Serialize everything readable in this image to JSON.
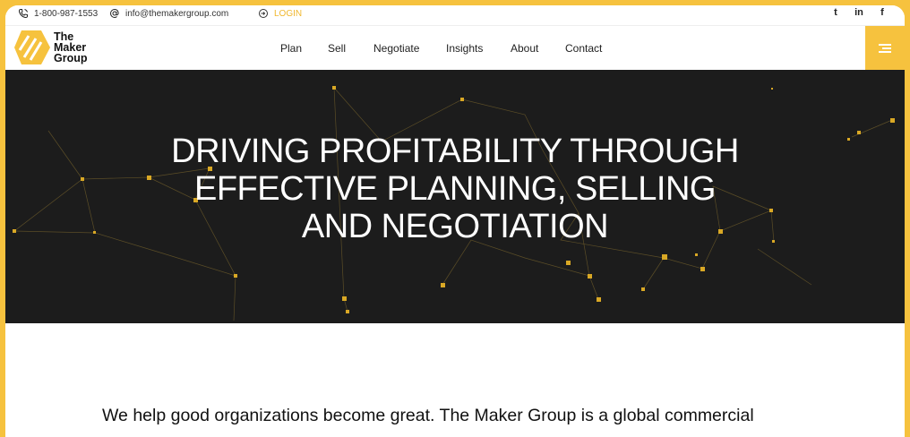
{
  "contact": {
    "phone": "1-800-987-1553",
    "email": "info@themakergroup.com",
    "login": "LOGIN"
  },
  "social": {
    "twitter": "t",
    "linkedin": "in",
    "facebook": "f"
  },
  "logo": {
    "line1": "The",
    "line2": "Maker",
    "line3": "Group"
  },
  "nav": [
    "Plan",
    "Sell",
    "Negotiate",
    "Insights",
    "About",
    "Contact"
  ],
  "hero": {
    "line1": "DRIVING PROFITABILITY THROUGH",
    "line2": "EFFECTIVE PLANNING, SELLING",
    "line3": "AND NEGOTIATION"
  },
  "intro": "We help good organizations become great. The Maker Group is a global commercial",
  "colors": {
    "accent": "#f6c23e",
    "hero_bg": "#1c1c1c"
  }
}
